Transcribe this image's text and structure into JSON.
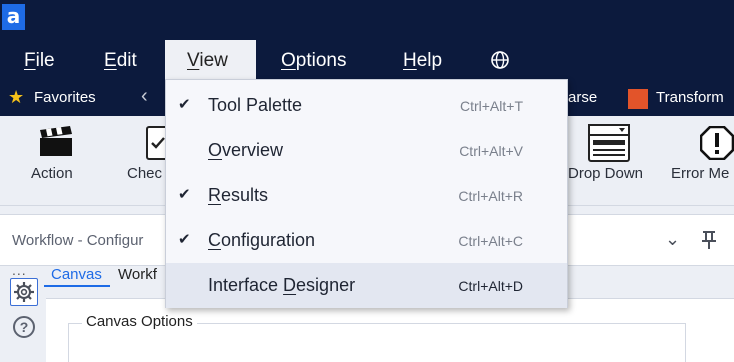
{
  "app": {
    "logo_text": "a"
  },
  "menubar": {
    "items": [
      {
        "id": "file",
        "pre": "",
        "u": "F",
        "post": "ile"
      },
      {
        "id": "edit",
        "pre": "",
        "u": "E",
        "post": "dit"
      },
      {
        "id": "view",
        "pre": "",
        "u": "V",
        "post": "iew"
      },
      {
        "id": "options",
        "pre": "",
        "u": "O",
        "post": "ptions"
      },
      {
        "id": "help",
        "pre": "",
        "u": "H",
        "post": "elp"
      }
    ],
    "globe_icon": "globe-icon"
  },
  "favorites": {
    "label": "Favorites",
    "star_icon": "star-icon",
    "arrow": "‹",
    "parse_label": "arse",
    "transform_label": "Transform"
  },
  "ribbon": {
    "tools": [
      {
        "id": "action",
        "label": "Action",
        "icon": "clapperboard-icon"
      },
      {
        "id": "check",
        "label": "Chec",
        "icon": "check-box-icon"
      },
      {
        "id": "dropdown",
        "label": "Drop Down",
        "icon": "dropdown-icon"
      },
      {
        "id": "error",
        "label": "Error Me",
        "icon": "error-icon"
      }
    ]
  },
  "pane": {
    "title": "Workflow - Configur",
    "chevron": "⌄",
    "dots": "...",
    "help": "?",
    "tabs": {
      "canvas": "Canvas",
      "workflow": "Workf"
    },
    "canvas_options_label": "Canvas Options"
  },
  "view_menu": {
    "items": [
      {
        "checked": true,
        "pre": "Tool Palette",
        "u": "",
        "post": "",
        "shortcut": "Ctrl+Alt+T"
      },
      {
        "checked": false,
        "pre": "",
        "u": "O",
        "post": "verview",
        "shortcut": "Ctrl+Alt+V"
      },
      {
        "checked": true,
        "pre": "",
        "u": "R",
        "post": "esults",
        "shortcut": "Ctrl+Alt+R"
      },
      {
        "checked": true,
        "pre": "",
        "u": "C",
        "post": "onfiguration",
        "shortcut": "Ctrl+Alt+C"
      },
      {
        "checked": false,
        "pre": "Interface ",
        "u": "D",
        "post": "esigner",
        "shortcut": "Ctrl+Alt+D",
        "hover": true
      }
    ],
    "check_glyph": "✔"
  },
  "colors": {
    "titlebar": "#0c1a3d",
    "accent": "#1e6be6",
    "transform": "#e2542a",
    "star": "#f6c21a"
  }
}
